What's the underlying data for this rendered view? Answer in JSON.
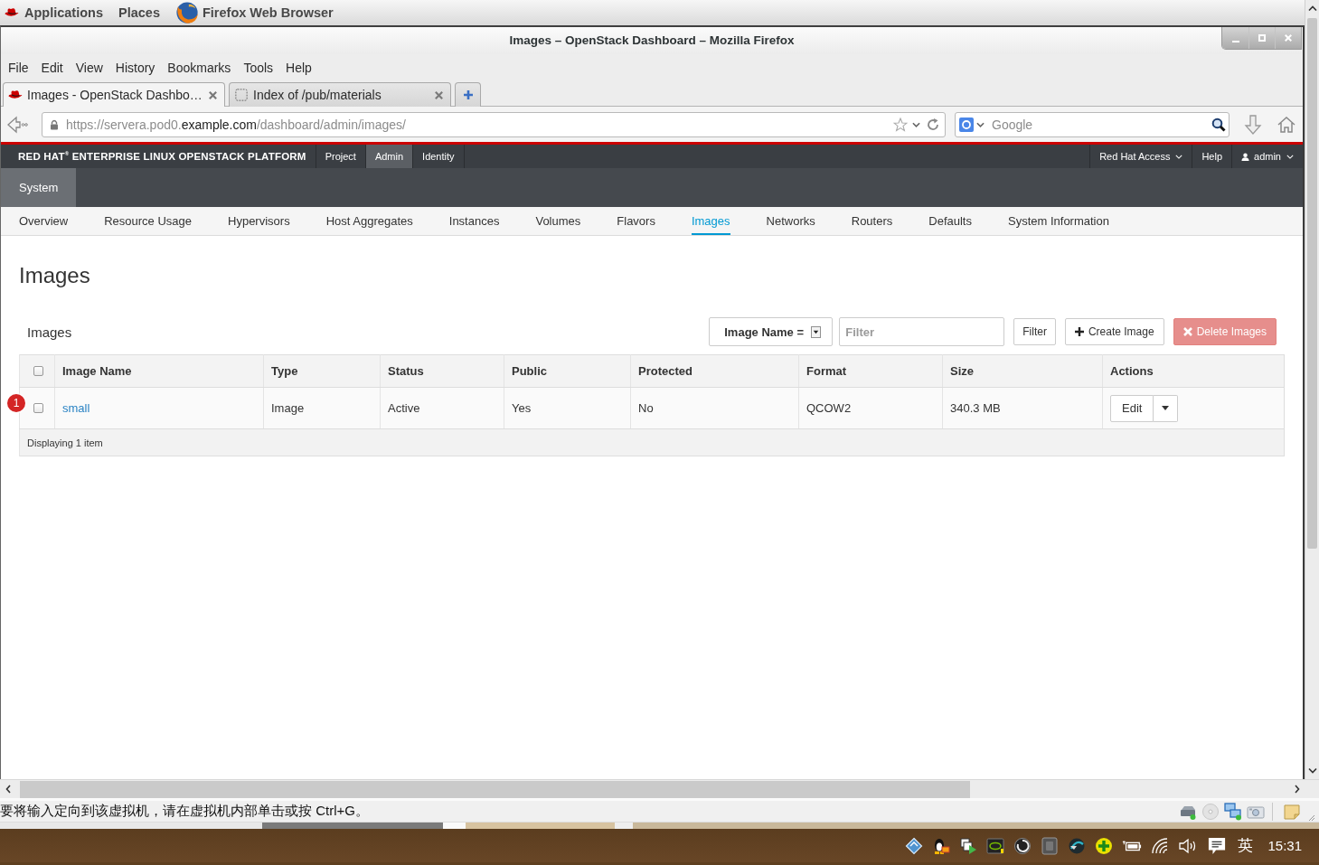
{
  "desktop_bar": {
    "applications": "Applications",
    "places": "Places",
    "app": "Firefox Web Browser"
  },
  "window": {
    "title": "Images – OpenStack Dashboard – Mozilla Firefox"
  },
  "menu": [
    "File",
    "Edit",
    "View",
    "History",
    "Bookmarks",
    "Tools",
    "Help"
  ],
  "tabs": [
    {
      "label": "Images - OpenStack Dashbo…",
      "selected": true,
      "kind": "redhat"
    },
    {
      "label": "Index of /pub/materials",
      "selected": false,
      "kind": "blank"
    }
  ],
  "address": {
    "host_prefix": "https://servera.pod0.",
    "domain": "example.com",
    "path": "/dashboard/admin/images/"
  },
  "search": {
    "placeholder": "Google"
  },
  "topnav": {
    "brand": "RED HAT$^{®}$ ENTERPRISE LINUX OPENSTACK PLATFORM",
    "dashboards": [
      {
        "label": "Project",
        "selected": false
      },
      {
        "label": "Admin",
        "selected": true
      },
      {
        "label": "Identity",
        "selected": false
      }
    ],
    "right": [
      {
        "label": "Red Hat Access",
        "kind": "dropdown"
      },
      {
        "label": "Help",
        "kind": "link"
      },
      {
        "label": "admin",
        "kind": "user"
      }
    ]
  },
  "panel_groups": [
    {
      "label": "System",
      "selected": true
    }
  ],
  "subnav": [
    {
      "label": "Overview",
      "selected": false
    },
    {
      "label": "Resource Usage",
      "selected": false
    },
    {
      "label": "Hypervisors",
      "selected": false
    },
    {
      "label": "Host Aggregates",
      "selected": false
    },
    {
      "label": "Instances",
      "selected": false
    },
    {
      "label": "Volumes",
      "selected": false
    },
    {
      "label": "Flavors",
      "selected": false
    },
    {
      "label": "Images",
      "selected": true
    },
    {
      "label": "Networks",
      "selected": false
    },
    {
      "label": "Routers",
      "selected": false
    },
    {
      "label": "Defaults",
      "selected": false
    },
    {
      "label": "System Information",
      "selected": false
    }
  ],
  "page": {
    "heading": "Images"
  },
  "table": {
    "title": "Images",
    "filter_select": {
      "value": "Image Name ="
    },
    "filter_input": {
      "placeholder": "Filter"
    },
    "actions": [
      {
        "label": "Filter",
        "kind": "plain",
        "disabled": false
      },
      {
        "label": "Create Image",
        "kind": "create",
        "disabled": false
      },
      {
        "label": "Delete Images",
        "kind": "delete",
        "disabled": true
      }
    ],
    "select_all": {
      "checked": false
    },
    "columns": [
      "Image Name",
      "Type",
      "Status",
      "Public",
      "Protected",
      "Format",
      "Size",
      "Actions"
    ],
    "rows": [
      {
        "checked": false,
        "cells": [
          "small",
          "Image",
          "Active",
          "Yes",
          "No",
          "QCOW2",
          "340.3 MB"
        ],
        "action": "Edit"
      }
    ],
    "footer": "Displaying 1 item"
  },
  "annotation": {
    "label": "1"
  },
  "viewer_status": {
    "message": "要将输入定向到该虚拟机，请在虚拟机内部单击或按 Ctrl+G。"
  },
  "taskbar": {
    "ime": "英",
    "clock": "15:31"
  }
}
